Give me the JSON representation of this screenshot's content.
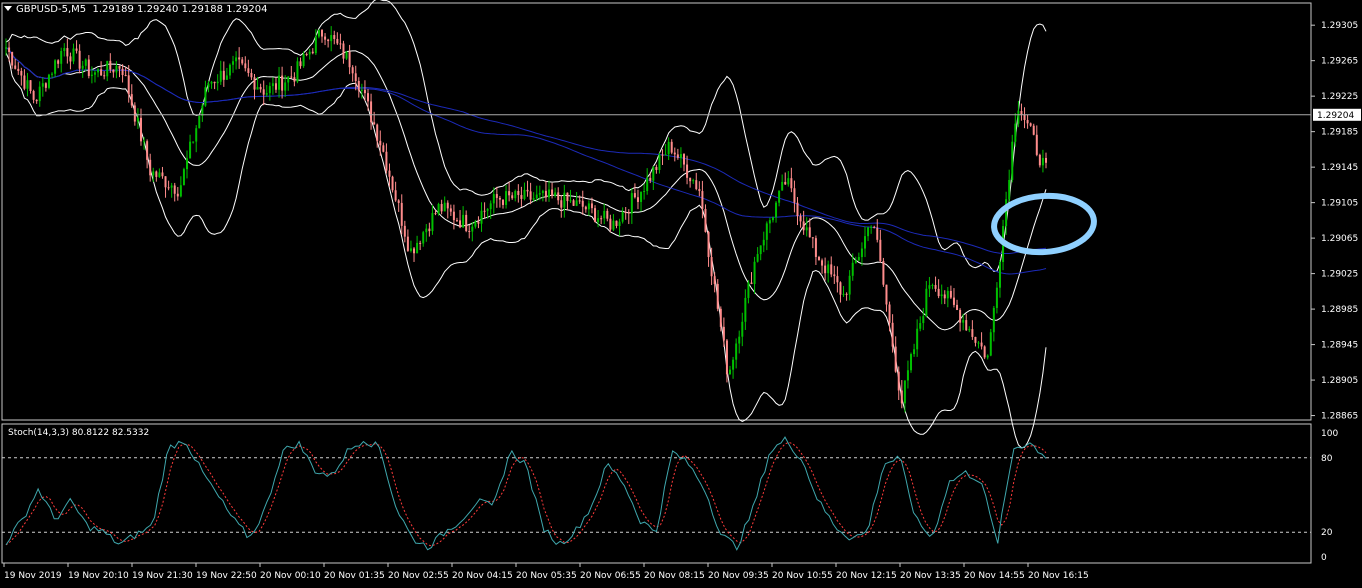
{
  "window": {
    "title": "GBPUSD-5,M5",
    "ohlc": "1.29189 1.29240 1.29188 1.29204"
  },
  "colors": {
    "background": "#000000",
    "bull": "#00c000",
    "bear": "#ff8c8c",
    "bands": "#ffffff",
    "ma": "#1c2ab8",
    "stoch_main": "#3fa7ad",
    "stoch_signal": "#ff3b3b",
    "highlight": "#8fd0ff"
  },
  "chart_data": {
    "type": "candlestick",
    "symbol": "GBPUSD-5",
    "timeframe": "M5",
    "current_price_label": "1.29204",
    "current_price": 1.29204,
    "y_ticks": [
      "1.29305",
      "1.29265",
      "1.29225",
      "1.29185",
      "1.29145",
      "1.29105",
      "1.29065",
      "1.29025",
      "1.28985",
      "1.28945",
      "1.28905",
      "1.28865"
    ],
    "ylim": [
      1.2886,
      1.2933
    ],
    "x_ticks": [
      "19 Nov 2019",
      "19 Nov 20:10",
      "19 Nov 21:30",
      "19 Nov 22:50",
      "20 Nov 00:10",
      "20 Nov 01:35",
      "20 Nov 02:55",
      "20 Nov 04:15",
      "20 Nov 05:35",
      "20 Nov 06:55",
      "20 Nov 08:15",
      "20 Nov 09:35",
      "20 Nov 10:55",
      "20 Nov 12:15",
      "20 Nov 13:35",
      "20 Nov 14:55",
      "20 Nov 16:15"
    ],
    "anchors": [
      1.2928,
      1.2922,
      1.2928,
      1.2925,
      1.2926,
      1.2914,
      1.2912,
      1.2924,
      1.2926,
      1.2923,
      1.2925,
      1.293,
      1.2926,
      1.2917,
      1.2905,
      1.291,
      1.2908,
      1.2911,
      1.2911,
      1.2911,
      1.291,
      1.2908,
      1.2912,
      1.2917,
      1.2912,
      1.2891,
      1.2905,
      1.2913,
      1.2905,
      1.29,
      1.2909,
      1.2888,
      1.2902,
      1.2898,
      1.2893,
      1.2922,
      1.2914
    ],
    "indicators": [
      "Bollinger Bands",
      "Moving Average (blue)",
      "Moving Average (blue)"
    ],
    "stochastic": {
      "label": "Stoch(14,3,3) 80.8122 82.5332",
      "main": 80.8122,
      "signal": 82.5332,
      "y_ticks": [
        "100",
        "80",
        "20",
        "0"
      ],
      "levels": [
        80,
        20
      ],
      "anchors": [
        12,
        30,
        55,
        30,
        45,
        25,
        20,
        10,
        18,
        25,
        88,
        95,
        70,
        50,
        30,
        15,
        40,
        85,
        92,
        70,
        65,
        85,
        95,
        88,
        40,
        15,
        8,
        20,
        30,
        45,
        40,
        85,
        75,
        25,
        10,
        20,
        40,
        75,
        60,
        30,
        20,
        85,
        75,
        55,
        18,
        8,
        40,
        85,
        95,
        78,
        45,
        25,
        15,
        20,
        75,
        80,
        30,
        15,
        60,
        68,
        62,
        10,
        88,
        92,
        81
      ]
    }
  }
}
